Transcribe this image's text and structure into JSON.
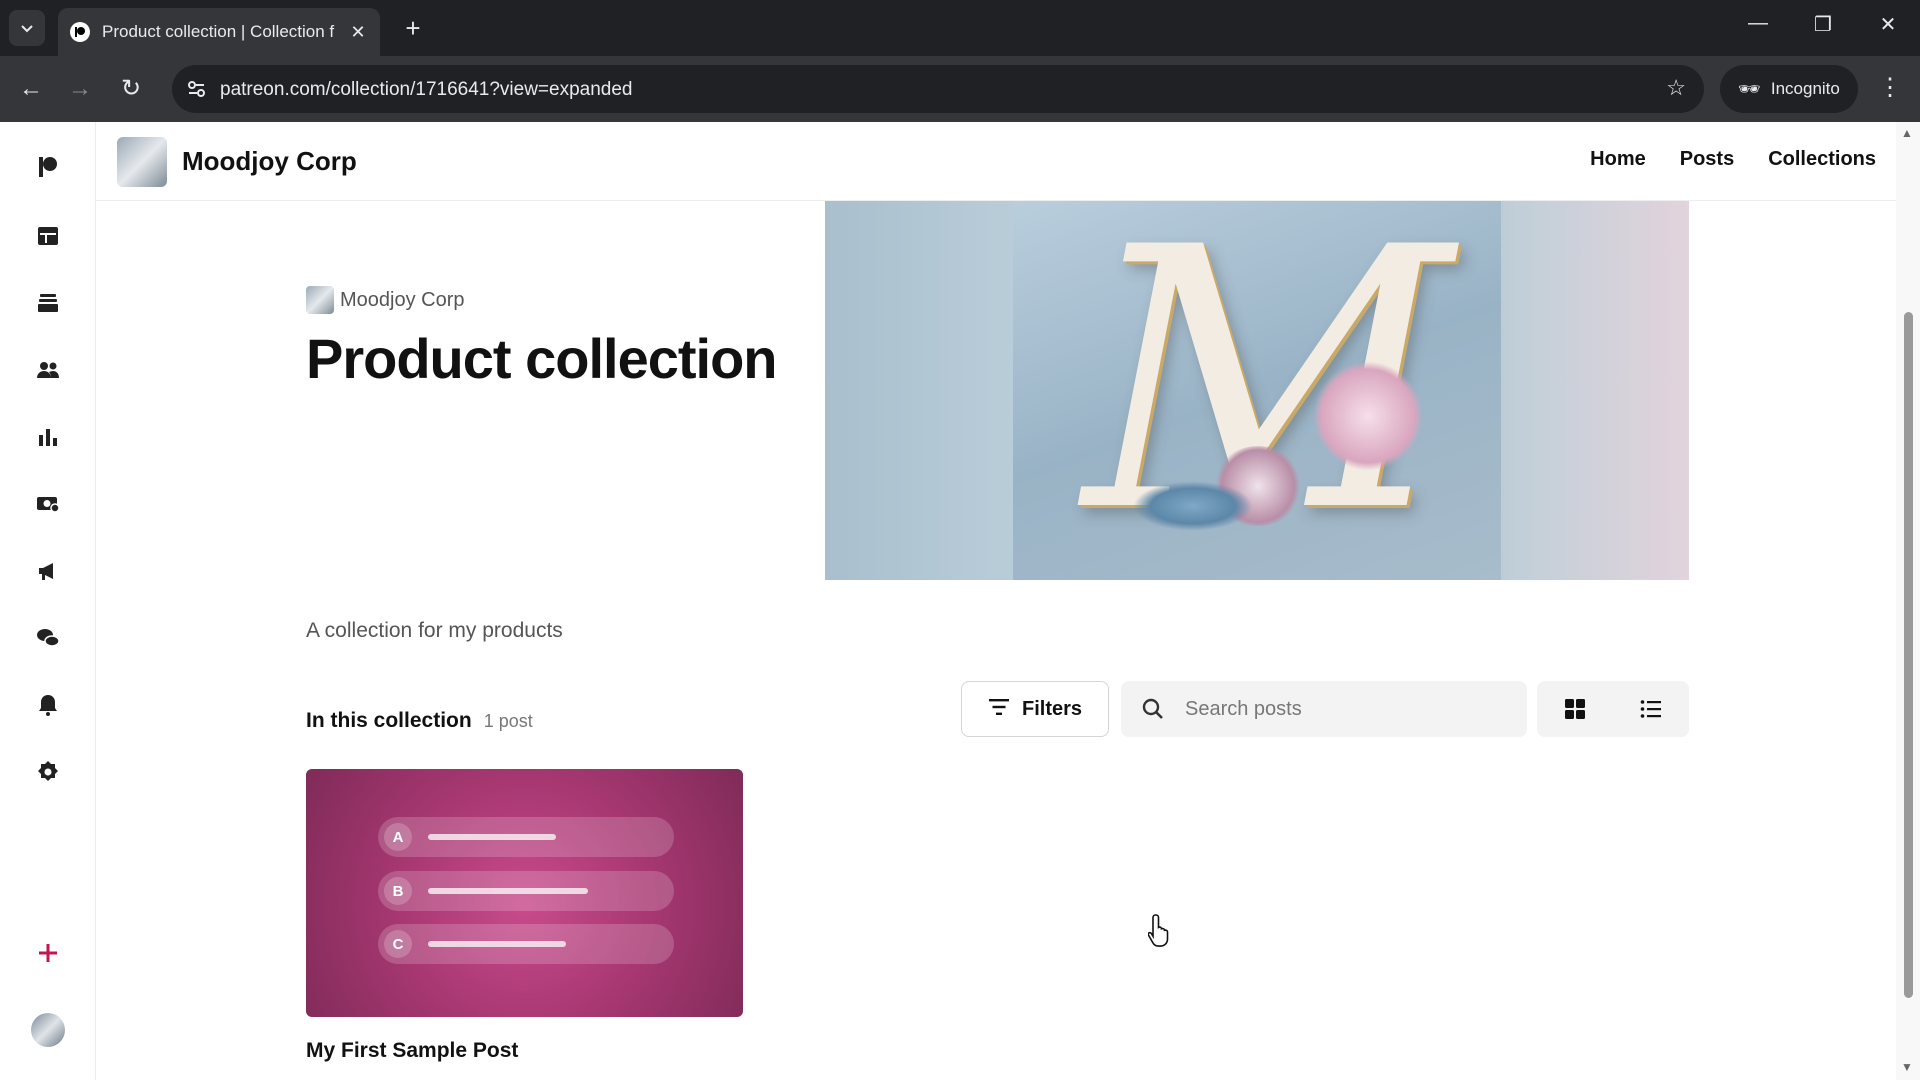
{
  "browser": {
    "tab_title": "Product collection | Collection f",
    "url": "patreon.com/collection/1716641?view=expanded",
    "incognito_label": "Incognito"
  },
  "header": {
    "creator_name": "Moodjoy Corp",
    "nav": [
      {
        "label": "Home"
      },
      {
        "label": "Posts"
      },
      {
        "label": "Collections"
      }
    ]
  },
  "sidebar": {
    "icons": [
      "patreon-logo-icon",
      "dashboard-icon",
      "library-icon",
      "audience-icon",
      "insights-icon",
      "payouts-icon",
      "promotions-icon",
      "chats-icon",
      "notifications-icon",
      "settings-icon",
      "plus-icon",
      "avatar"
    ]
  },
  "collection": {
    "byline": "Moodjoy Corp",
    "title": "Product collection",
    "description": "A collection for my products",
    "section_title": "In this collection",
    "count": "1 post"
  },
  "controls": {
    "filters_label": "Filters",
    "search_placeholder": "Search posts"
  },
  "posts": [
    {
      "title": "My First Sample Post",
      "options": [
        "A",
        "B",
        "C"
      ]
    }
  ],
  "colors": {
    "post_thumb_accent": "#a63771",
    "browser_dark": "#202124"
  }
}
